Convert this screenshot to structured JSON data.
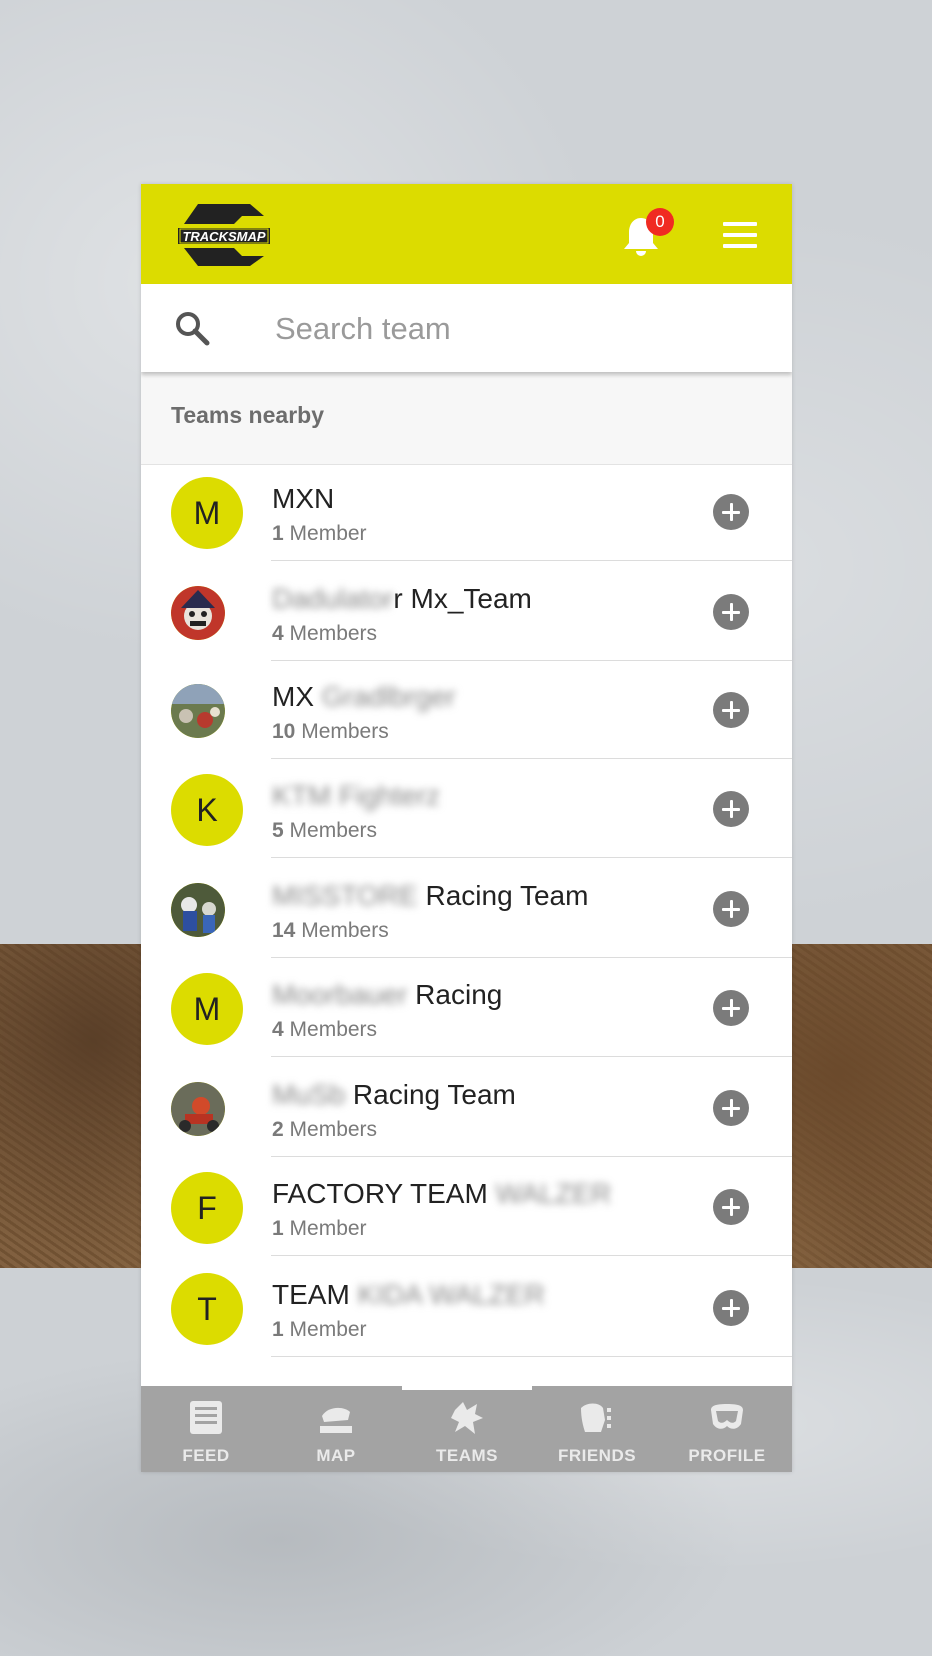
{
  "brand": {
    "logo_text": "TRACKSMAP",
    "accent": "#dcdc00"
  },
  "header": {
    "notification_count": "0"
  },
  "search": {
    "placeholder": "Search team",
    "value": ""
  },
  "section": {
    "title": "Teams nearby"
  },
  "teams": [
    {
      "initial": "M",
      "avatar": "letter",
      "name_visible": "MXN",
      "name_hidden": "",
      "count": "1",
      "unit": "Member"
    },
    {
      "initial": "",
      "avatar": "photo",
      "name_hidden": "Dadulator",
      "name_visible": "r Mx_Team",
      "count": "4",
      "unit": "Members"
    },
    {
      "initial": "",
      "avatar": "photo",
      "name_visible": "MX",
      "name_hidden": "Gradlbrger",
      "count": "10",
      "unit": "Members"
    },
    {
      "initial": "K",
      "avatar": "letter",
      "name_visible": "",
      "name_hidden": "KTM Fighterz",
      "count": "5",
      "unit": "Members"
    },
    {
      "initial": "",
      "avatar": "photo",
      "name_hidden": "MISSTORE",
      "name_visible": " Racing Team",
      "count": "14",
      "unit": "Members"
    },
    {
      "initial": "M",
      "avatar": "letter",
      "name_hidden": "Moorbauer",
      "name_visible": " Racing",
      "count": "4",
      "unit": "Members"
    },
    {
      "initial": "",
      "avatar": "photo",
      "name_hidden": "MuSb",
      "name_visible": " Racing Team",
      "count": "2",
      "unit": "Members"
    },
    {
      "initial": "F",
      "avatar": "letter",
      "name_visible": "FACTORY TEAM ",
      "name_hidden": "WALZER",
      "count": "1",
      "unit": "Member"
    },
    {
      "initial": "T",
      "avatar": "letter",
      "name_visible": "TEAM ",
      "name_hidden": "KIDA WALZER",
      "count": "1",
      "unit": "Member"
    }
  ],
  "nav": [
    {
      "label": "FEED",
      "icon": "feed-icon"
    },
    {
      "label": "MAP",
      "icon": "map-icon"
    },
    {
      "label": "TEAMS",
      "icon": "teams-icon",
      "active": true
    },
    {
      "label": "FRIENDS",
      "icon": "friends-icon"
    },
    {
      "label": "PROFILE",
      "icon": "profile-icon"
    }
  ]
}
